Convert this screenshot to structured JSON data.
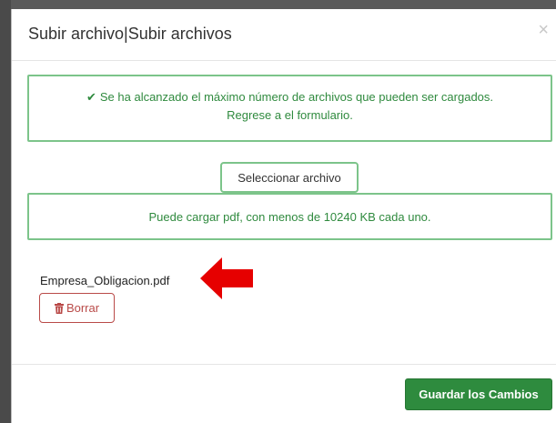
{
  "modal": {
    "title": "Subir archivo|Subir archivos",
    "close_glyph": "×"
  },
  "alert": {
    "icon": "check-icon",
    "line1": "Se ha alcanzado el máximo número de archivos que pueden ser cargados.",
    "line2": "Regrese a el formulario."
  },
  "upload": {
    "select_label": "Seleccionar archivo",
    "info_text": "Puede cargar pdf, con menos de 10240 KB cada uno."
  },
  "files": [
    {
      "name": "Empresa_Obligacion.pdf",
      "delete_label": "Borrar",
      "delete_icon": "trash-icon"
    }
  ],
  "footer": {
    "save_label": "Guardar los Cambios"
  },
  "colors": {
    "success": "#2f8a3e",
    "success_border": "#7cc48a",
    "danger": "#b94a48",
    "primary_button": "#2e8b3e",
    "annotation_arrow": "#e60000"
  }
}
